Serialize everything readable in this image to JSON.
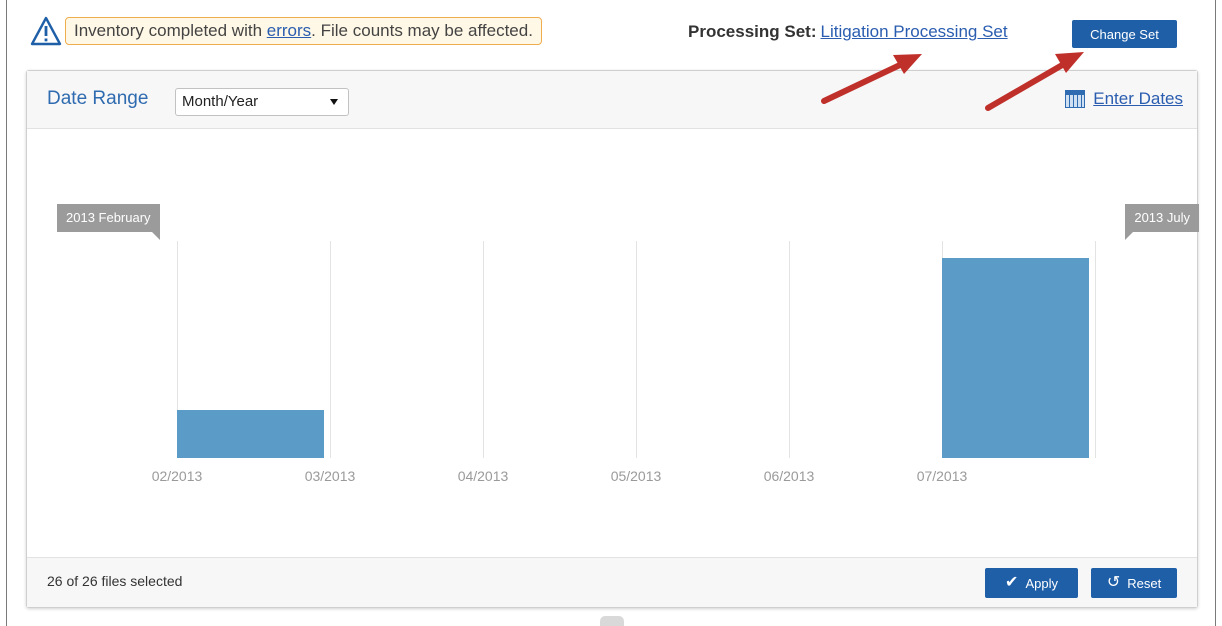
{
  "banner": {
    "warning_prefix": "Inventory completed with ",
    "warning_link": "errors",
    "warning_suffix": ". File counts may be affected.",
    "icon": "warning-triangle-icon"
  },
  "processing_set": {
    "label": "Processing Set:",
    "value": "Litigation Processing Set",
    "change_button": "Change Set"
  },
  "filter": {
    "date_range_label": "Date Range",
    "granularity_selected": "Month/Year",
    "enter_dates_label": "Enter Dates"
  },
  "chart_data": {
    "type": "bar",
    "categories": [
      "02/2013",
      "03/2013",
      "04/2013",
      "05/2013",
      "06/2013",
      "07/2013"
    ],
    "values": [
      0.24,
      0,
      0,
      0,
      0,
      1
    ],
    "title": "",
    "xlabel": "",
    "ylabel": "",
    "range_start_label": "2013 February",
    "range_end_label": "2013 July",
    "bar_color": "#5b9bc8",
    "grid": true
  },
  "footer": {
    "selection_text": "26 of 26 files selected",
    "apply_label": "Apply",
    "reset_label": "Reset"
  },
  "colors": {
    "accent": "#1f5fa8",
    "link": "#2a5db0",
    "annotation_arrow": "#c0302b"
  }
}
